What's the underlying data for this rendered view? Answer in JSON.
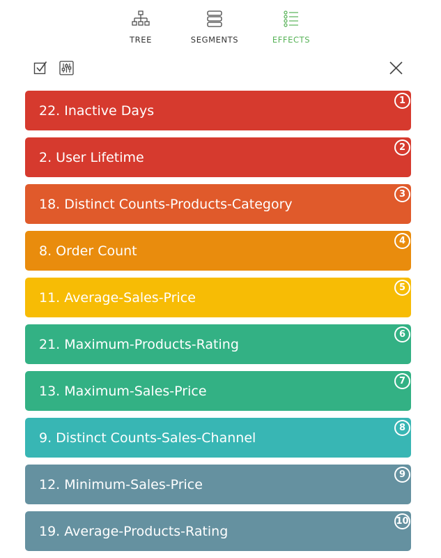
{
  "tabs": [
    {
      "label": "TREE",
      "icon": "tree-icon",
      "active": false
    },
    {
      "label": "SEGMENTS",
      "icon": "segments-icon",
      "active": false
    },
    {
      "label": "EFFECTS",
      "icon": "effects-list-icon",
      "active": true
    }
  ],
  "toolbar": {
    "icons": [
      "checkbox-icon",
      "sliders-icon",
      "close-icon"
    ]
  },
  "colors": {
    "active_tab": "#56b256",
    "tab_inactive": "#333333"
  },
  "effects": [
    {
      "rank": "1",
      "label": "22. Inactive Days",
      "color": "#d63a2e"
    },
    {
      "rank": "2",
      "label": "2. User Lifetime",
      "color": "#d63a2e"
    },
    {
      "rank": "3",
      "label": "18. Distinct Counts-Products-Category",
      "color": "#e05a2b"
    },
    {
      "rank": "4",
      "label": "8. Order Count",
      "color": "#e98c0d"
    },
    {
      "rank": "5",
      "label": "11. Average-Sales-Price",
      "color": "#f7bc05"
    },
    {
      "rank": "6",
      "label": "21. Maximum-Products-Rating",
      "color": "#33b184"
    },
    {
      "rank": "7",
      "label": "13. Maximum-Sales-Price",
      "color": "#33b184"
    },
    {
      "rank": "8",
      "label": "9. Distinct Counts-Sales-Channel",
      "color": "#38b6b4"
    },
    {
      "rank": "9",
      "label": "12. Minimum-Sales-Price",
      "color": "#6591a0"
    },
    {
      "rank": "10",
      "label": "19. Average-Products-Rating",
      "color": "#6591a0"
    }
  ]
}
